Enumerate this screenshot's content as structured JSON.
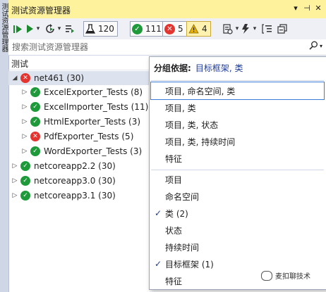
{
  "side_tab": {
    "text": "测试资源管理器"
  },
  "window": {
    "title": "测试资源管理器",
    "controls": {
      "dropdown": "▾",
      "pin": "⊣",
      "close": "✕"
    }
  },
  "toolbar": {
    "counters": [
      {
        "name": "total",
        "value": "120",
        "icon": "flask-icon"
      },
      {
        "name": "passed",
        "value": "111",
        "icon": "check-icon",
        "color": "#1f9a3a"
      },
      {
        "name": "failed",
        "value": "5",
        "icon": "x-icon",
        "color": "#e3342f"
      },
      {
        "name": "warnings",
        "value": "4",
        "icon": "warning-icon",
        "color": "#e9b000"
      }
    ]
  },
  "search": {
    "placeholder": "搜索测试资源管理器"
  },
  "tree_header": {
    "label": "测试"
  },
  "tree": [
    {
      "label": "net461 (30)",
      "status": "fail",
      "expanded": true,
      "level": 0
    },
    {
      "label": "ExcelExporter_Tests (8)",
      "status": "pass",
      "expanded": false,
      "level": 1
    },
    {
      "label": "ExcelImporter_Tests (11)",
      "status": "pass",
      "expanded": false,
      "level": 1
    },
    {
      "label": "HtmlExporter_Tests (3)",
      "status": "pass",
      "expanded": false,
      "level": 1
    },
    {
      "label": "PdfExporter_Tests (5)",
      "status": "fail",
      "expanded": false,
      "level": 1
    },
    {
      "label": "WordExporter_Tests (3)",
      "status": "pass",
      "expanded": false,
      "level": 1
    },
    {
      "label": "netcoreapp2.2 (30)",
      "status": "pass",
      "expanded": false,
      "level": 0
    },
    {
      "label": "netcoreapp3.0 (30)",
      "status": "pass",
      "expanded": false,
      "level": 0
    },
    {
      "label": "netcoreapp3.1 (30)",
      "status": "pass",
      "expanded": false,
      "level": 0
    }
  ],
  "popup": {
    "heading_label": "分组依据:",
    "heading_value": "目标框架, 类",
    "presets": [
      {
        "label": "项目, 命名空间, 类",
        "selected": true
      },
      {
        "label": "项目, 类"
      },
      {
        "label": "项目, 类, 状态"
      },
      {
        "label": "项目, 类, 持续时间"
      },
      {
        "label": "特征"
      }
    ],
    "options": [
      {
        "label": "项目",
        "checked": false
      },
      {
        "label": "命名空间",
        "checked": false
      },
      {
        "label": "类 (2)",
        "checked": true
      },
      {
        "label": "状态",
        "checked": false
      },
      {
        "label": "持续时间",
        "checked": false
      },
      {
        "label": "目标框架 (1)",
        "checked": true
      },
      {
        "label": "特征",
        "checked": false
      }
    ],
    "check_glyph": "✓"
  },
  "watermark": {
    "text": "麦扣聊技术"
  }
}
